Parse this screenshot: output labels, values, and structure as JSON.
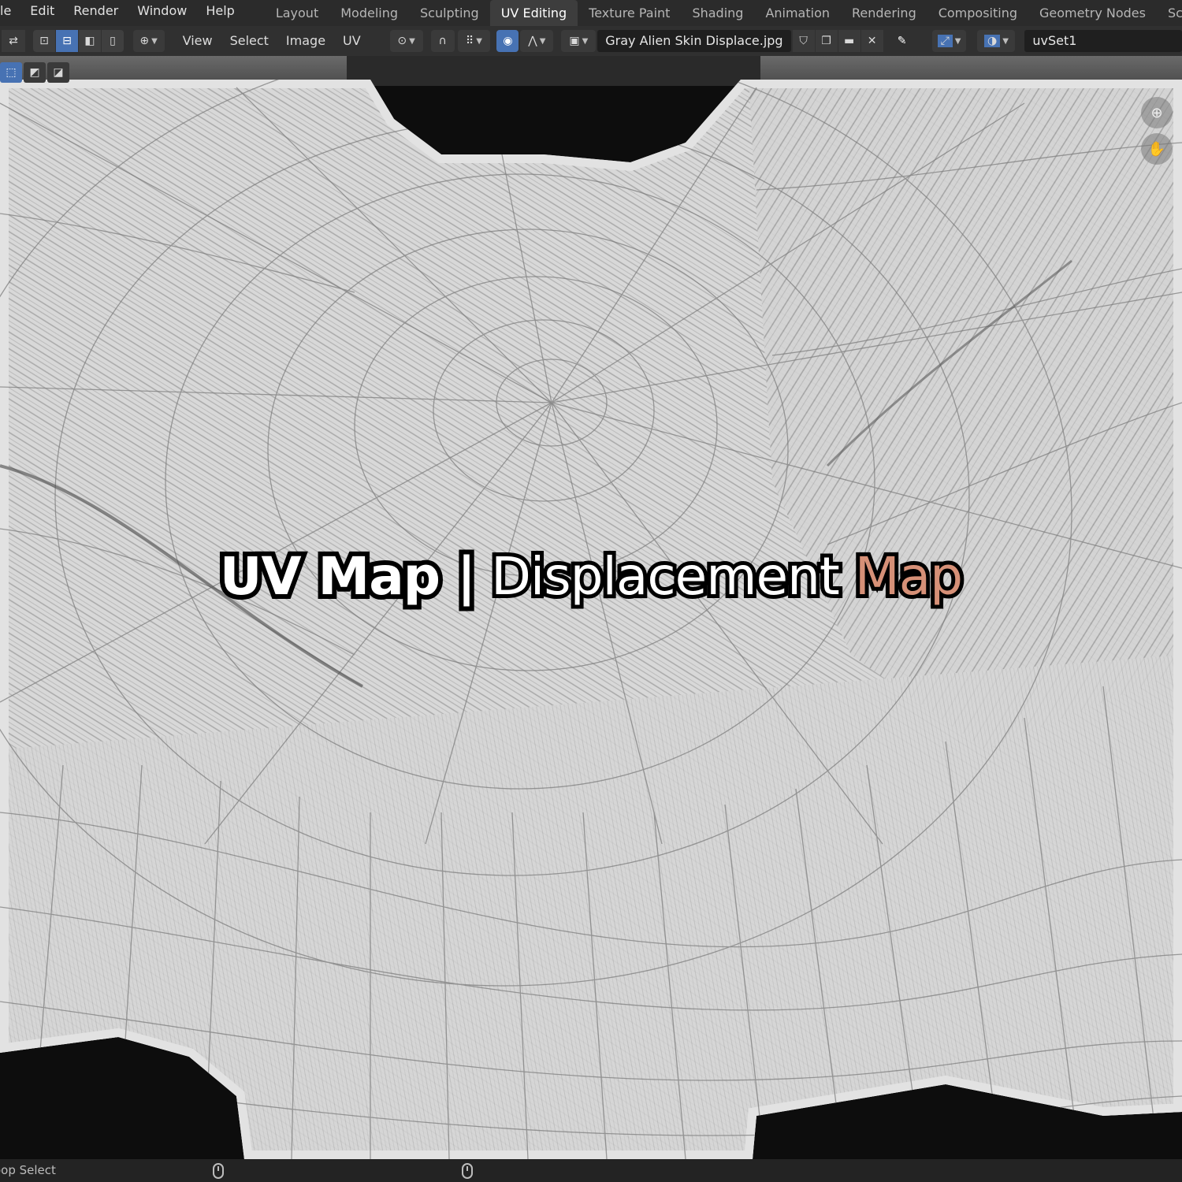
{
  "menubar": {
    "items": [
      "le",
      "Edit",
      "Render",
      "Window",
      "Help"
    ]
  },
  "workspaces": {
    "tabs": [
      "Layout",
      "Modeling",
      "Sculpting",
      "UV Editing",
      "Texture Paint",
      "Shading",
      "Animation",
      "Rendering",
      "Compositing",
      "Geometry Nodes",
      "Scripting"
    ],
    "active": "UV Editing"
  },
  "header": {
    "menus": [
      "View",
      "Select",
      "Image",
      "UV"
    ],
    "image_name": "Gray Alien Skin Displace.jpg",
    "uv_map": "uvSet1"
  },
  "overlay": {
    "part1": "UV Map |",
    "part2": "Displacement",
    "part3": "Map",
    "accent_color": "#d69077"
  },
  "statusbar": {
    "left_text": "oop Select"
  },
  "icons": {
    "zoom": "zoom-icon",
    "pan": "hand-pan-icon",
    "pin": "pin-icon",
    "close": "close-icon"
  },
  "colors": {
    "topbar": "#2b2b2b",
    "header": "#303030",
    "active_tab": "#3d3d3d",
    "selected_button": "#4772b3",
    "uv_fill": "#d9d9d9",
    "uv_edge": "#7a7a7a"
  }
}
